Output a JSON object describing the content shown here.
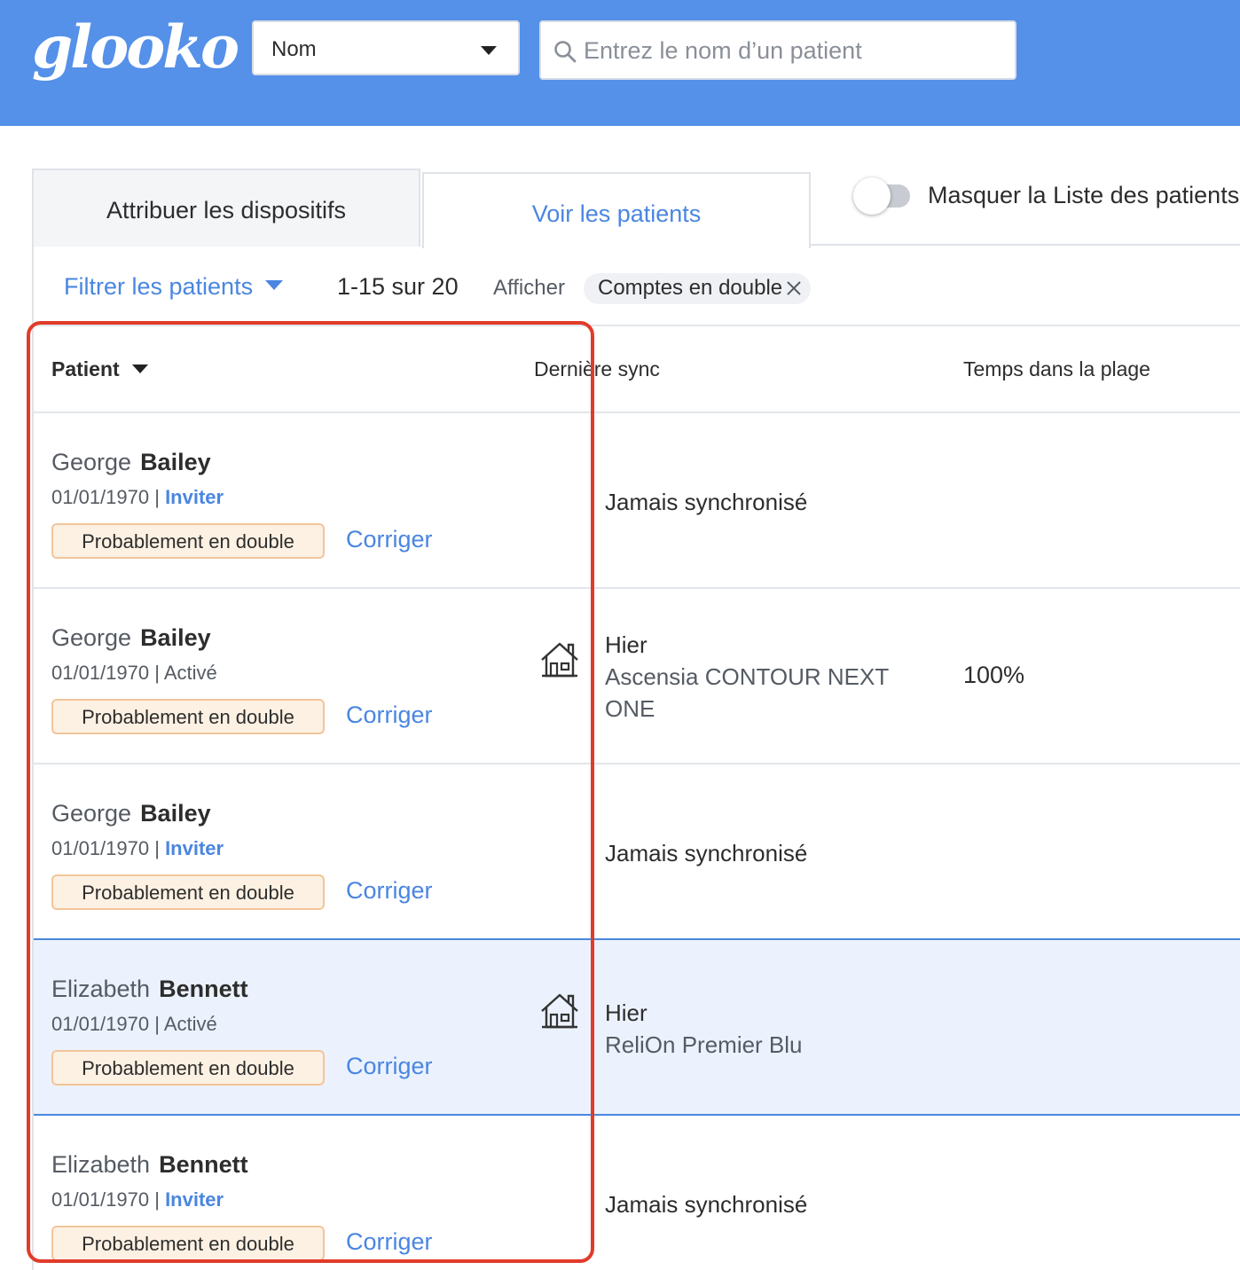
{
  "header": {
    "logo": "glooko",
    "search_by": {
      "selected": "Nom"
    },
    "search": {
      "placeholder": "Entrez le nom d’un patient",
      "value": ""
    }
  },
  "tabs": [
    {
      "label": "Attribuer les dispositifs",
      "active": false
    },
    {
      "label": "Voir les patients",
      "active": true
    }
  ],
  "toggle": {
    "label": "Masquer la Liste des patients",
    "on": false
  },
  "toolbar": {
    "filter_label": "Filtrer les patients",
    "count": "1-15 sur 20",
    "show_label": "Afficher",
    "chip_label": "Comptes en double"
  },
  "table": {
    "columns": [
      "Patient",
      "Dernière sync",
      "Temps dans la plage"
    ],
    "rows": [
      {
        "first": "George",
        "last": "Bailey",
        "dob": "01/01/1970",
        "sep": " | ",
        "status": "Inviter",
        "status_link": true,
        "badge": "Probablement en double",
        "action": "Corriger",
        "home_icon": false,
        "sync": "Jamais synchronisé",
        "device": "",
        "tir": "",
        "selected": false
      },
      {
        "first": "George",
        "last": "Bailey",
        "dob": "01/01/1970",
        "sep": " | ",
        "status": "Activé",
        "status_link": false,
        "badge": "Probablement en double",
        "action": "Corriger",
        "home_icon": true,
        "sync": "Hier",
        "device": "Ascensia CONTOUR NEXT ONE",
        "tir": "100%",
        "selected": false
      },
      {
        "first": "George",
        "last": "Bailey",
        "dob": "01/01/1970",
        "sep": " | ",
        "status": "Inviter",
        "status_link": true,
        "badge": "Probablement en double",
        "action": "Corriger",
        "home_icon": false,
        "sync": "Jamais synchronisé",
        "device": "",
        "tir": "",
        "selected": false
      },
      {
        "first": "Elizabeth",
        "last": "Bennett",
        "dob": "01/01/1970",
        "sep": " | ",
        "status": "Activé",
        "status_link": false,
        "badge": "Probablement en double",
        "action": "Corriger",
        "home_icon": true,
        "sync": "Hier",
        "device": "ReliOn Premier Blu",
        "tir": "",
        "selected": true
      },
      {
        "first": "Elizabeth",
        "last": "Bennett",
        "dob": "01/01/1970",
        "sep": " | ",
        "status": "Inviter",
        "status_link": true,
        "badge": "Probablement en double",
        "action": "Corriger",
        "home_icon": false,
        "sync": "Jamais synchronisé",
        "device": "",
        "tir": "",
        "selected": false
      }
    ]
  },
  "colors": {
    "header": "#5590e9",
    "link": "#4a86e0",
    "badge_bg": "#fdf1e3",
    "badge_border": "#f2c59a",
    "selected_row": "#ebf2fd",
    "highlight": "#e23b2a"
  },
  "icons": {
    "search": "search-icon",
    "dropdown": "chevron-down-icon",
    "remove": "close-icon",
    "home": "home-icon"
  }
}
